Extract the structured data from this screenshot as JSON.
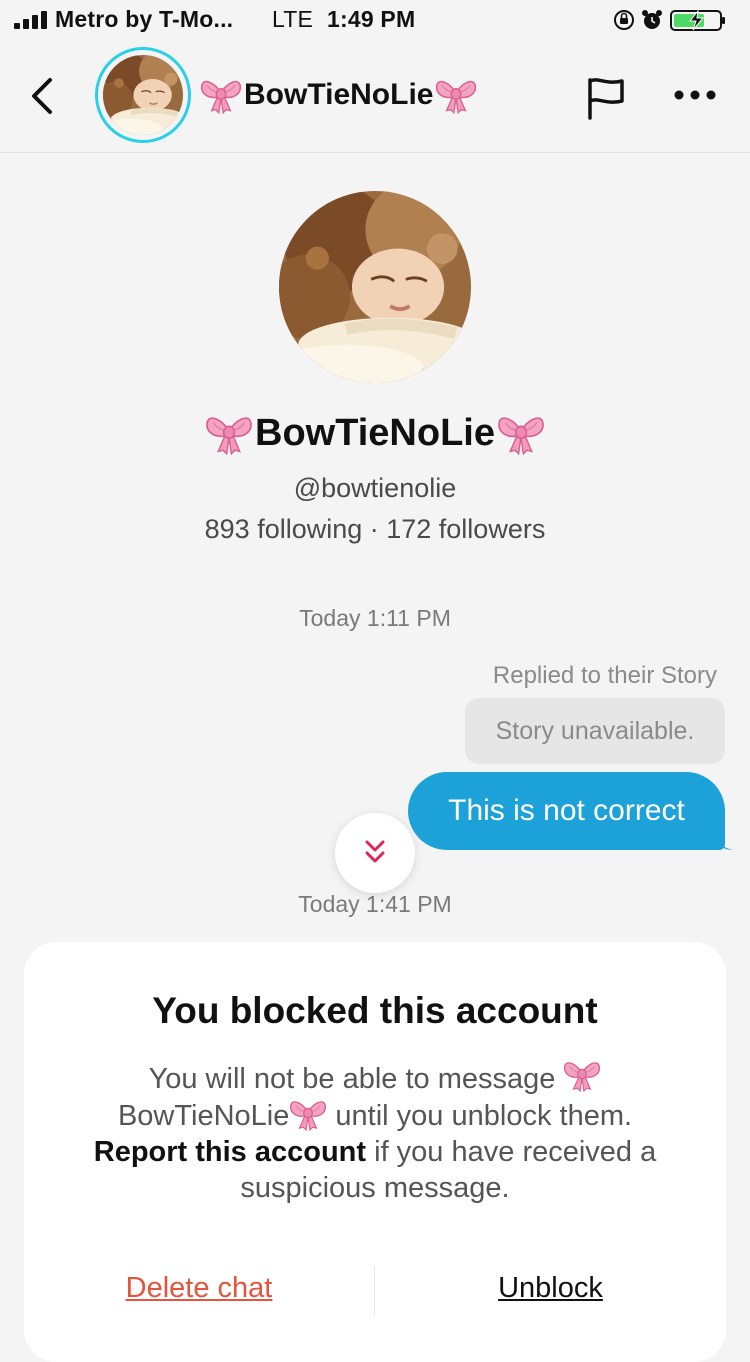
{
  "status_bar": {
    "carrier": "Metro by T-Mo...",
    "network": "LTE",
    "time": "1:49 PM",
    "icons": [
      "signal-icon",
      "orientation-lock-icon",
      "alarm-icon",
      "battery-charging-icon"
    ]
  },
  "header": {
    "display_name": "BowTieNoLie",
    "name_decoration_icon": "pink-bow-icon"
  },
  "profile": {
    "display_name": "BowTieNoLie",
    "handle": "@bowtienolie",
    "stats": "893 following · 172 followers"
  },
  "chat": {
    "timestamp_1": "Today 1:11 PM",
    "reply_label": "Replied to their Story",
    "story_unavailable": "Story unavailable.",
    "message": "This is not correct",
    "timestamp_2": "Today 1:41 PM"
  },
  "blocked": {
    "title": "You blocked this account",
    "body_part_1": "You will not be able to message",
    "body_name": "BowTieNoLie",
    "body_part_2": "until you unblock them.",
    "report_link": "Report this account",
    "body_part_3": "if you have received a suspicious message.",
    "delete_label": "Delete chat",
    "unblock_label": "Unblock"
  },
  "colors": {
    "accent_blue": "#1ca2d9",
    "story_ring": "#2ad0e8",
    "delete_red": "#e5553e",
    "bow_pink": "#f4a3c3"
  }
}
